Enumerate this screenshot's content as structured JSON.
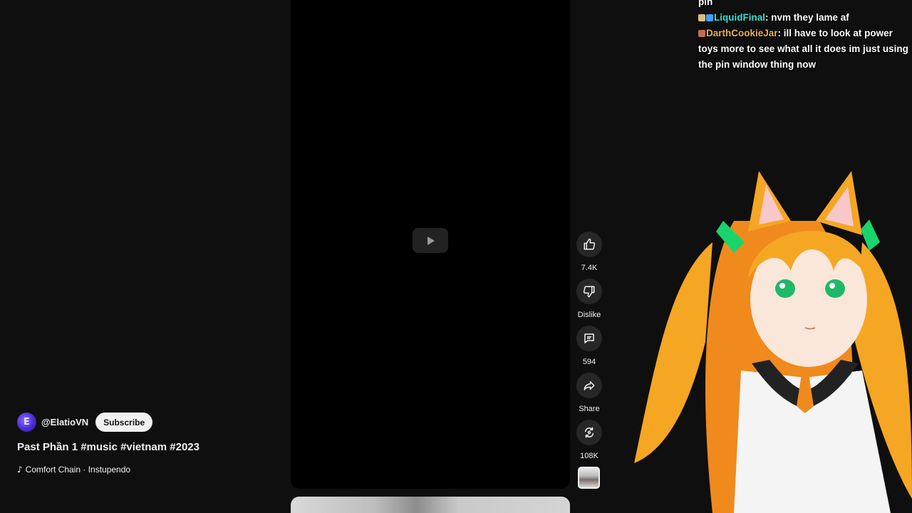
{
  "channel": {
    "avatar_letter": "E",
    "name": "@ElatioVN",
    "subscribe_label": "Subscribe"
  },
  "video": {
    "title": "Past Phần 1 #music #vietnam #2023",
    "music": "Comfort Chain · Instupendo"
  },
  "actions": {
    "like_count": "7.4K",
    "dislike_label": "Dislike",
    "comment_count": "594",
    "share_label": "Share",
    "remix_count": "108K"
  },
  "chat": {
    "partial_line": "pin",
    "messages": [
      {
        "user": "LiquidFinal",
        "text": "nvm they lame af"
      },
      {
        "user": "DarthCookieJar",
        "text": "ill have to look at power toys more to see what all it does im just using the pin window thing now"
      }
    ]
  },
  "colors": {
    "background": "#0f0f0f",
    "action_button": "#272727",
    "subscribe_bg": "#f1f1f1",
    "chat_user_1": "#2ee6d9",
    "chat_user_2": "#e8b04a",
    "vtuber_hair": "#f5a623"
  }
}
